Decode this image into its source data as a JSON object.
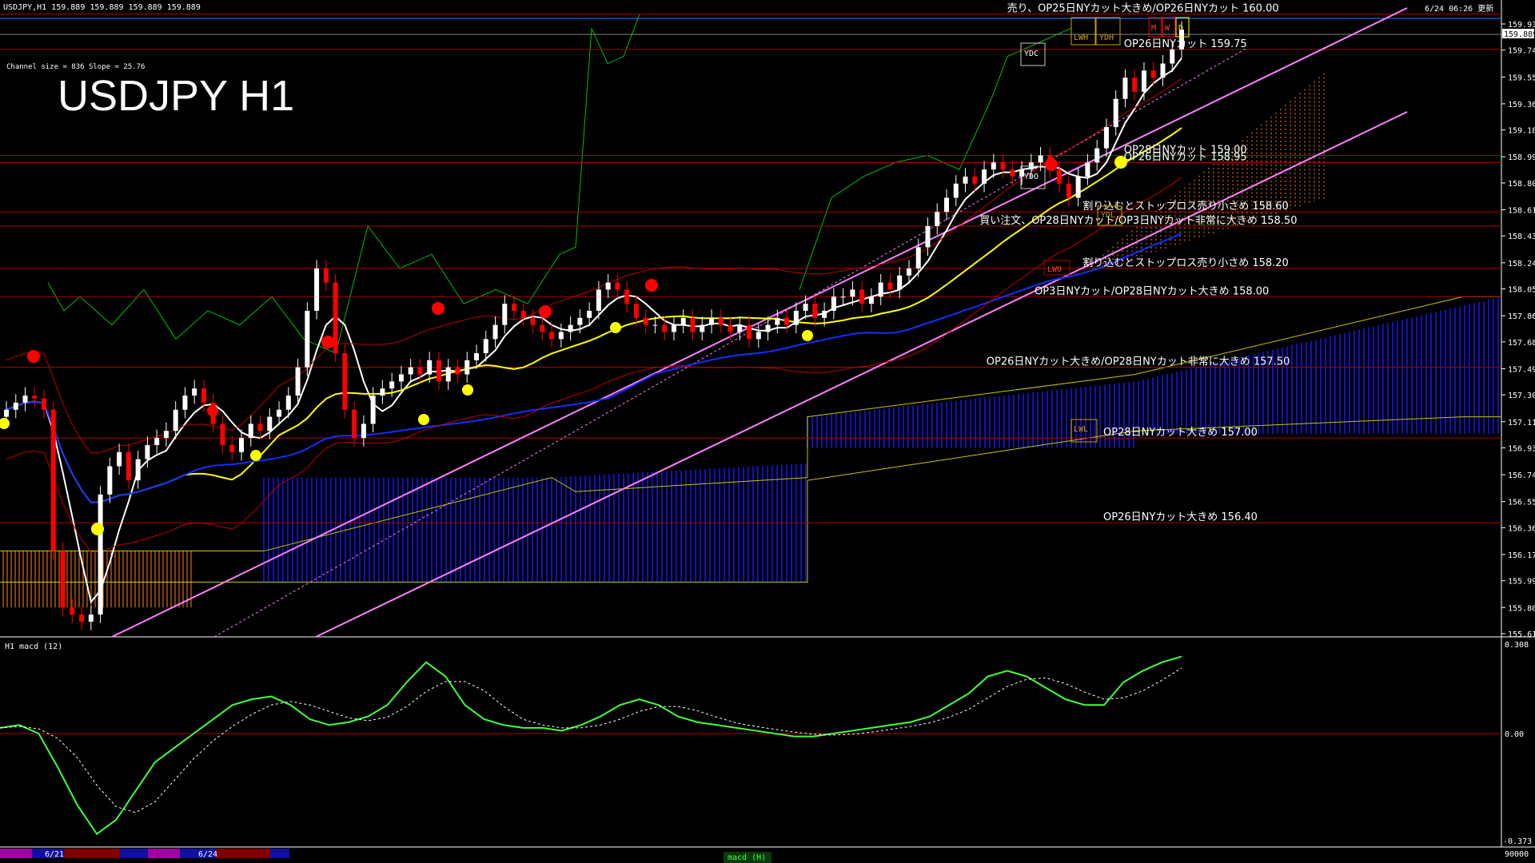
{
  "header": {
    "symbol_line": "USDJPY,H1  159.889 159.889 159.889 159.889",
    "big_title": "USDJPY H1",
    "channel_info": "Channel size = 836 Slope = 25.76",
    "updated": "6/24 06:26 更新",
    "current_price": "159.889"
  },
  "price_axis": {
    "ticks": [
      "159.930",
      "159.745",
      "159.555",
      "159.365",
      "159.180",
      "158.990",
      "158.805",
      "158.615",
      "158.430",
      "158.240",
      "158.055",
      "157.865",
      "157.680",
      "157.490",
      "157.305",
      "157.115",
      "156.930",
      "156.740",
      "156.550",
      "156.365",
      "156.175",
      "155.990",
      "155.800",
      "155.615"
    ]
  },
  "levels": [
    {
      "label": "売り、OP25日NYカット大きめ/OP26日NYカット 160.00",
      "price": 160.0
    },
    {
      "label": "OP26日NYカット 159.75",
      "price": 159.75
    },
    {
      "label": "OP28日NYカット 159.00",
      "price": 159.0
    },
    {
      "label": "OP26日NYカット 158.95",
      "price": 158.95
    },
    {
      "label": "割り込むとストップロス売り小さめ 158.60",
      "price": 158.6
    },
    {
      "label": "買い注文、OP28日NYカット/OP3日NYカット非常に大きめ 158.50",
      "price": 158.5
    },
    {
      "label": "割り込むとストップロス売り小さめ 158.20",
      "price": 158.2
    },
    {
      "label": "OP3日NYカット/OP28日NYカット大きめ 158.00",
      "price": 158.0
    },
    {
      "label": "OP26日NYカット大きめ/OP28日NYカット非常に大きめ 157.50",
      "price": 157.5
    },
    {
      "label": "OP28日NYカット大きめ 157.00",
      "price": 157.0
    },
    {
      "label": "OP26日NYカット大きめ 156.40",
      "price": 156.4
    }
  ],
  "markers": {
    "ydc": "YDC",
    "ydh": "YDH",
    "lwh": "LWH",
    "ydo": "YDO",
    "ydl": "YDL",
    "lwl": "LWL",
    "lwo": "LWO",
    "m": "M",
    "w": "W",
    "d": "D"
  },
  "macd_panel": {
    "title": "H1  macd (12)",
    "ticks": [
      "0.308",
      "0.00",
      "-0.373"
    ],
    "bottom_right": "90000"
  },
  "time_axis": {
    "labels": [
      "6/21",
      "6/24"
    ],
    "indicator_tab": "macd (H)"
  },
  "colors": {
    "bg": "#000000",
    "bull": "#ffffff",
    "bear": "#ff0000",
    "level_line": "#b00000",
    "channel": "#ff80ff",
    "cloud_blue": "#1010c0",
    "cloud_orange": "#ff8020",
    "span_yellow": "#c8c800",
    "chikou_green": "#00c000",
    "ma_white": "#ffffff",
    "ma_yellow": "#ffff00",
    "ma_blue": "#1030ff",
    "macd_green": "#40ff40",
    "macd_pink": "#ff80a0",
    "macd_signal": "#ffffff"
  },
  "chart_data": {
    "type": "candlestick",
    "symbol": "USDJPY",
    "timeframe": "H1",
    "ylim": [
      155.615,
      159.93
    ],
    "close_prices": [
      157.2,
      157.25,
      157.3,
      157.28,
      157.2,
      156.2,
      155.8,
      155.75,
      155.7,
      155.75,
      156.6,
      156.8,
      156.9,
      156.7,
      156.85,
      156.95,
      157.0,
      157.05,
      157.2,
      157.3,
      157.35,
      157.25,
      157.1,
      156.95,
      156.9,
      157.0,
      157.1,
      157.05,
      157.15,
      157.2,
      157.3,
      157.5,
      157.9,
      158.2,
      158.1,
      157.6,
      157.2,
      157.0,
      157.1,
      157.3,
      157.35,
      157.4,
      157.45,
      157.5,
      157.45,
      157.55,
      157.4,
      157.5,
      157.45,
      157.55,
      157.6,
      157.7,
      157.8,
      157.95,
      157.9,
      157.85,
      157.8,
      157.75,
      157.7,
      157.75,
      157.8,
      157.85,
      157.9,
      158.05,
      158.1,
      158.05,
      157.95,
      157.85,
      157.8,
      157.8,
      157.75,
      157.8,
      157.85,
      157.75,
      157.8,
      157.85,
      157.8,
      157.75,
      157.8,
      157.7,
      157.75,
      157.8,
      157.85,
      157.8,
      157.9,
      157.95,
      157.85,
      157.9,
      158.0,
      158.0,
      158.05,
      157.95,
      158.0,
      158.1,
      158.05,
      158.15,
      158.2,
      158.35,
      158.5,
      158.6,
      158.7,
      158.8,
      158.85,
      158.8,
      158.9,
      158.95,
      158.9,
      158.85,
      158.9,
      158.95,
      159.0,
      158.9,
      158.8,
      158.7,
      158.85,
      158.95,
      159.05,
      159.2,
      159.4,
      159.55,
      159.45,
      159.6,
      159.55,
      159.65,
      159.75,
      159.89
    ]
  }
}
